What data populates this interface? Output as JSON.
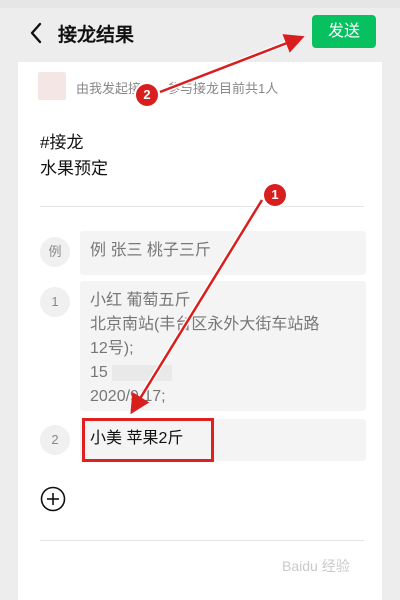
{
  "header": {
    "title": "接龙结果",
    "send_label": "发送"
  },
  "post": {
    "info_text": "由我发起接龙，参与接龙目前共1人",
    "tag": "#接龙",
    "subject": "水果预定"
  },
  "entries": [
    {
      "number": "例",
      "lines": [
        "例 张三 桃子三斤"
      ]
    },
    {
      "number": "1",
      "lines": [
        "小红 葡萄五斤",
        "北京南站(丰台区永外大街车站路",
        "12号);",
        "15",
        "2020/9/17;"
      ]
    },
    {
      "number": "2",
      "lines": [
        "小美 苹果2斤"
      ]
    }
  ],
  "annotations": {
    "marker_1": "1",
    "marker_2": "2",
    "arrow_color": "#d91e1e"
  },
  "watermark": "Baidu 经验",
  "colors": {
    "accent": "#07c160",
    "highlight": "#e02020",
    "background": "#ededed"
  }
}
